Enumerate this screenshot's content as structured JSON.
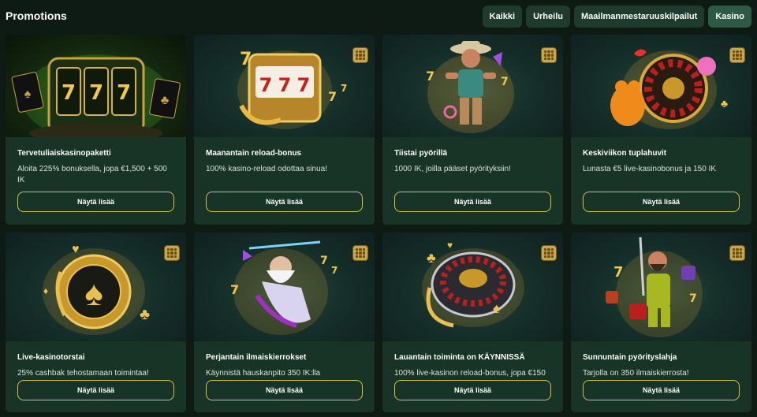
{
  "header": {
    "title": "Promotions",
    "filters": [
      "Kaikki",
      "Urheilu",
      "Maailmanmestaruuskilpailut",
      "Kasino"
    ],
    "active_filter": "Kasino"
  },
  "colors": {
    "background": "#0e1a14",
    "card": "#173426",
    "button_border": "#d8c04a",
    "filter_bg": "#1f3b2e"
  },
  "promotions": [
    {
      "title": "Tervetuliaiskasinopaketti",
      "description": "Aloita 225% bonuksella, jopa €1,500 + 500 IK",
      "button": "Näytä lisää",
      "image": "slot-machine"
    },
    {
      "title": "Maanantain reload-bonus",
      "description": "100% kasino-reload odottaa sinua!",
      "button": "Näytä lisää",
      "image": "slot-machine-gold"
    },
    {
      "title": "Tiistai pyörillä",
      "description": "1000 IK, joilla pääset pyörityksiin!",
      "button": "Näytä lisää",
      "image": "cowboy-character"
    },
    {
      "title": "Keskiviikon tuplahuvit",
      "description": "Lunasta €5 live-kasinobonus ja 150 IK",
      "button": "Näytä lisää",
      "image": "roulette-candy"
    },
    {
      "title": "Live-kasinotorstai",
      "description": "25% cashbak tehostamaan toimintaa!",
      "button": "Näytä lisää",
      "image": "poker-chip"
    },
    {
      "title": "Perjantain ilmaiskierrokset",
      "description": "Käynnistä hauskanpito 350 IK:lla",
      "button": "Näytä lisää",
      "image": "zeus-character"
    },
    {
      "title": "Lauantain toiminta on KÄYNNISSÄ",
      "description": "100% live-kasinon reload-bonus, jopa €150",
      "button": "Näytä lisää",
      "image": "roulette-wheel"
    },
    {
      "title": "Sunnuntain pyörityslahja",
      "description": "Tarjolla on 350 ilmaiskierrosta!",
      "button": "Näytä lisää",
      "image": "miner-character"
    }
  ]
}
